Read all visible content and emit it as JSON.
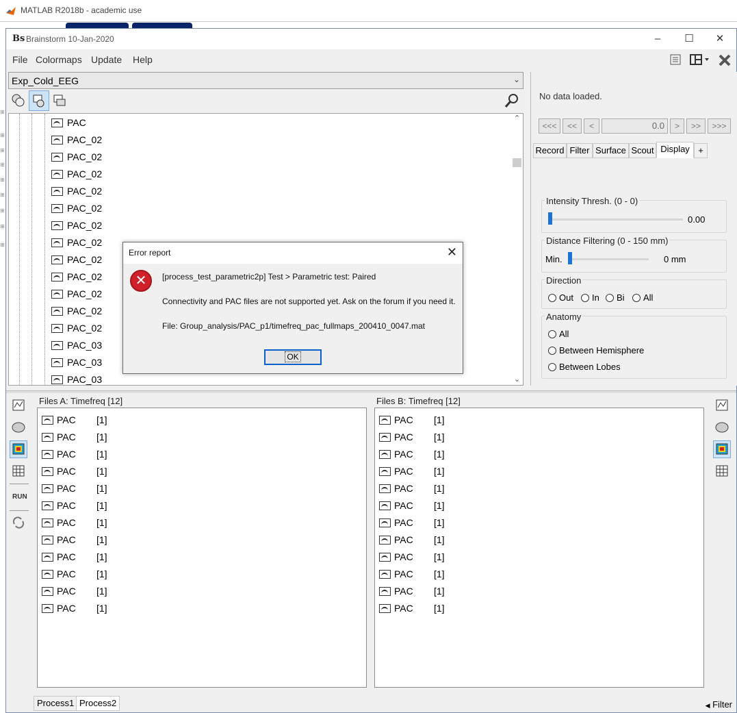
{
  "matlab": {
    "title": "MATLAB R2018b - academic use"
  },
  "window": {
    "title": "Brainstorm 10-Jan-2020",
    "logo": "Bs"
  },
  "menu": [
    "File",
    "Colormaps",
    "Update",
    "Help"
  ],
  "protocol": {
    "selected": "Exp_Cold_EEG"
  },
  "tree": {
    "items": [
      "PAC",
      "PAC_02",
      "PAC_02",
      "PAC_02",
      "PAC_02",
      "PAC_02",
      "PAC_02",
      "PAC_02",
      "PAC_02",
      "PAC_02",
      "PAC_02",
      "PAC_02",
      "PAC_02",
      "PAC_03",
      "PAC_03",
      "PAC_03"
    ]
  },
  "right_panel": {
    "status": "No data loaded.",
    "nav": [
      "<<<",
      "<<",
      "<",
      ">",
      ">>",
      ">>>"
    ],
    "time_value": "0.0",
    "tabs": [
      "Record",
      "Filter",
      "Surface",
      "Scout",
      "Display",
      "+"
    ],
    "active_tab": "Display",
    "intensity": {
      "label": "Intensity Thresh. (0 - 0)",
      "value": "0.00",
      "level": 0
    },
    "distance": {
      "label": "Distance Filtering (0 - 150 mm)",
      "min_label": "Min.",
      "value": "0 mm",
      "level": 0
    },
    "direction": {
      "label": "Direction",
      "options": [
        "Out",
        "In",
        "Bi",
        "All"
      ]
    },
    "anatomy": {
      "label": "Anatomy",
      "options": [
        "All",
        "Between Hemisphere",
        "Between Lobes"
      ]
    }
  },
  "files_a": {
    "title": "Files A: Timefreq [12]",
    "items": [
      {
        "name": "PAC",
        "count": "[1]"
      },
      {
        "name": "PAC",
        "count": "[1]"
      },
      {
        "name": "PAC",
        "count": "[1]"
      },
      {
        "name": "PAC",
        "count": "[1]"
      },
      {
        "name": "PAC",
        "count": "[1]"
      },
      {
        "name": "PAC",
        "count": "[1]"
      },
      {
        "name": "PAC",
        "count": "[1]"
      },
      {
        "name": "PAC",
        "count": "[1]"
      },
      {
        "name": "PAC",
        "count": "[1]"
      },
      {
        "name": "PAC",
        "count": "[1]"
      },
      {
        "name": "PAC",
        "count": "[1]"
      },
      {
        "name": "PAC",
        "count": "[1]"
      }
    ]
  },
  "files_b": {
    "title": "Files B: Timefreq [12]",
    "items": [
      {
        "name": "PAC",
        "count": "[1]"
      },
      {
        "name": "PAC",
        "count": "[1]"
      },
      {
        "name": "PAC",
        "count": "[1]"
      },
      {
        "name": "PAC",
        "count": "[1]"
      },
      {
        "name": "PAC",
        "count": "[1]"
      },
      {
        "name": "PAC",
        "count": "[1]"
      },
      {
        "name": "PAC",
        "count": "[1]"
      },
      {
        "name": "PAC",
        "count": "[1]"
      },
      {
        "name": "PAC",
        "count": "[1]"
      },
      {
        "name": "PAC",
        "count": "[1]"
      },
      {
        "name": "PAC",
        "count": "[1]"
      },
      {
        "name": "PAC",
        "count": "[1]"
      }
    ]
  },
  "side": {
    "run_label": "RUN"
  },
  "bottom_tabs": [
    "Process1",
    "Process2"
  ],
  "filter_label": "Filter",
  "dialog": {
    "title": "Error report",
    "line1": "[process_test_parametric2p]  Test > Parametric test: Paired",
    "line2": "Connectivity and PAC files are not supported yet. Ask on the forum if you need it.",
    "line3": "File: Group_analysis/PAC_p1/timefreq_pac_fullmaps_200410_0047.mat",
    "ok": "OK"
  },
  "colors": {
    "accent": "#1a74d6",
    "error": "#d0202a"
  }
}
